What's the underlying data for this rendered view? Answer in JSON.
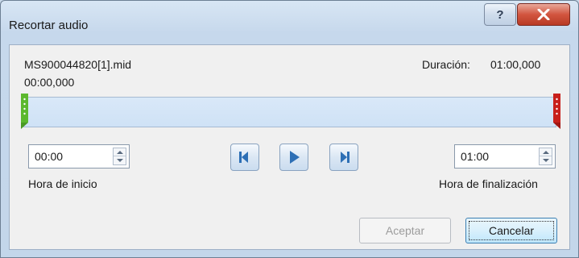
{
  "window": {
    "title": "Recortar audio",
    "help_symbol": "?",
    "close_icon": "close-x-icon"
  },
  "media": {
    "filename": "MS900044820[1].mid",
    "duration_label": "Duración:",
    "duration_value": "01:00,000",
    "current_position": "00:00,000"
  },
  "trim": {
    "start_time": "00:00",
    "start_label": "Hora de inicio",
    "end_time": "01:00",
    "end_label": "Hora de finalización"
  },
  "playback": {
    "previous_frame_icon": "previous-frame-icon",
    "play_icon": "play-icon",
    "next_frame_icon": "next-frame-icon"
  },
  "buttons": {
    "ok_label": "Aceptar",
    "cancel_label": "Cancelar"
  },
  "colors": {
    "start_marker": "#5cb82e",
    "end_marker": "#c8201b",
    "playback_accent": "#2d6fb5"
  }
}
